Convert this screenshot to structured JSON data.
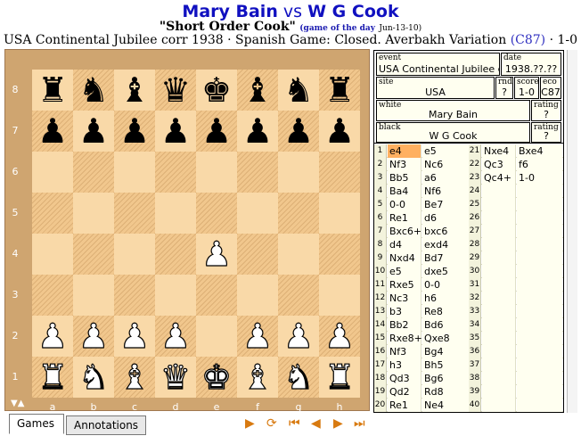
{
  "header": {
    "white_player": "Mary Bain",
    "vs": "vs",
    "black_player": "W G Cook",
    "nickname": "\"Short Order Cook\"",
    "gotd_label": "(game of the day",
    "gotd_date": "Jun-13-10)",
    "event_site": "USA Continental Jubilee corr 1938",
    "opening": "Spanish Game: Closed. Averbakh Variation",
    "eco_link": "(C87)",
    "result": "1-0",
    "dot": "·"
  },
  "board": {
    "ranks": [
      "8",
      "7",
      "6",
      "5",
      "4",
      "3",
      "2",
      "1"
    ],
    "files": [
      "a",
      "b",
      "c",
      "d",
      "e",
      "f",
      "g",
      "h"
    ],
    "flip_marker": "▼▲",
    "position": [
      [
        "bR",
        "bN",
        "bB",
        "bQ",
        "bK",
        "bB",
        "bN",
        "bR"
      ],
      [
        "bP",
        "bP",
        "bP",
        "bP",
        "bP",
        "bP",
        "bP",
        "bP"
      ],
      [
        "",
        "",
        "",
        "",
        "",
        "",
        "",
        ""
      ],
      [
        "",
        "",
        "",
        "",
        "",
        "",
        "",
        ""
      ],
      [
        "",
        "",
        "",
        "",
        "wP",
        "",
        "",
        ""
      ],
      [
        "",
        "",
        "",
        "",
        "",
        "",
        "",
        ""
      ],
      [
        "wP",
        "wP",
        "wP",
        "wP",
        "",
        "wP",
        "wP",
        "wP"
      ],
      [
        "wR",
        "wN",
        "wB",
        "wQ",
        "wK",
        "wB",
        "wN",
        "wR"
      ]
    ],
    "glyphs": {
      "K": "♚",
      "Q": "♛",
      "R": "♜",
      "B": "♝",
      "N": "♞",
      "P": "♟"
    },
    "colors": {
      "frame": "#cfa570",
      "light": "#f9d9a8",
      "dark": "#f1c78d"
    }
  },
  "info": {
    "event_label": "event",
    "event": "USA Continental Jubilee c",
    "date_label": "date",
    "date": "1938.??.??",
    "site_label": "site",
    "site": "USA",
    "rnd_label": "rnd",
    "rnd": "?",
    "score_label": "score",
    "score": "1-0",
    "eco_label": "eco",
    "eco": "C87",
    "white_label": "white",
    "white": "Mary Bain",
    "white_rating_label": "rating",
    "white_rating": "?",
    "black_label": "black",
    "black": "W G Cook",
    "black_rating_label": "rating",
    "black_rating": "?"
  },
  "moves": [
    {
      "n": "1",
      "w": "e4",
      "b": "e5"
    },
    {
      "n": "2",
      "w": "Nf3",
      "b": "Nc6"
    },
    {
      "n": "3",
      "w": "Bb5",
      "b": "a6"
    },
    {
      "n": "4",
      "w": "Ba4",
      "b": "Nf6"
    },
    {
      "n": "5",
      "w": "0-0",
      "b": "Be7"
    },
    {
      "n": "6",
      "w": "Re1",
      "b": "d6"
    },
    {
      "n": "7",
      "w": "Bxc6+",
      "b": "bxc6"
    },
    {
      "n": "8",
      "w": "d4",
      "b": "exd4"
    },
    {
      "n": "9",
      "w": "Nxd4",
      "b": "Bd7"
    },
    {
      "n": "10",
      "w": "e5",
      "b": "dxe5"
    },
    {
      "n": "11",
      "w": "Rxe5",
      "b": "0-0"
    },
    {
      "n": "12",
      "w": "Nc3",
      "b": "h6"
    },
    {
      "n": "13",
      "w": "b3",
      "b": "Re8"
    },
    {
      "n": "14",
      "w": "Bb2",
      "b": "Bd6"
    },
    {
      "n": "15",
      "w": "Rxe8+",
      "b": "Qxe8"
    },
    {
      "n": "16",
      "w": "Nf3",
      "b": "Bg4"
    },
    {
      "n": "17",
      "w": "h3",
      "b": "Bh5"
    },
    {
      "n": "18",
      "w": "Qd3",
      "b": "Bg6"
    },
    {
      "n": "19",
      "w": "Qd2",
      "b": "Rd8"
    },
    {
      "n": "20",
      "w": "Re1",
      "b": "Ne4"
    },
    {
      "n": "21",
      "w": "Nxe4",
      "b": "Bxe4"
    },
    {
      "n": "22",
      "w": "Qc3",
      "b": "f6"
    },
    {
      "n": "23",
      "w": "Qc4+",
      "b": "1-0"
    },
    {
      "n": "24",
      "w": "",
      "b": ""
    },
    {
      "n": "25",
      "w": "",
      "b": ""
    },
    {
      "n": "26",
      "w": "",
      "b": ""
    },
    {
      "n": "27",
      "w": "",
      "b": ""
    },
    {
      "n": "28",
      "w": "",
      "b": ""
    },
    {
      "n": "29",
      "w": "",
      "b": ""
    },
    {
      "n": "30",
      "w": "",
      "b": ""
    },
    {
      "n": "31",
      "w": "",
      "b": ""
    },
    {
      "n": "32",
      "w": "",
      "b": ""
    },
    {
      "n": "33",
      "w": "",
      "b": ""
    },
    {
      "n": "34",
      "w": "",
      "b": ""
    },
    {
      "n": "35",
      "w": "",
      "b": ""
    },
    {
      "n": "36",
      "w": "",
      "b": ""
    },
    {
      "n": "37",
      "w": "",
      "b": ""
    },
    {
      "n": "38",
      "w": "",
      "b": ""
    },
    {
      "n": "39",
      "w": "",
      "b": ""
    },
    {
      "n": "40",
      "w": "",
      "b": ""
    }
  ],
  "tabs": [
    {
      "label": "Games",
      "active": true
    },
    {
      "label": "Annotations",
      "active": false
    }
  ],
  "controls": [
    {
      "name": "play-icon",
      "glyph": "▶"
    },
    {
      "name": "flip-board-icon",
      "glyph": "⟳"
    },
    {
      "name": "first-move-icon",
      "glyph": "⏮"
    },
    {
      "name": "previous-move-icon",
      "glyph": "◀"
    },
    {
      "name": "next-move-icon",
      "glyph": "▶"
    },
    {
      "name": "last-move-icon",
      "glyph": "⏭"
    }
  ]
}
